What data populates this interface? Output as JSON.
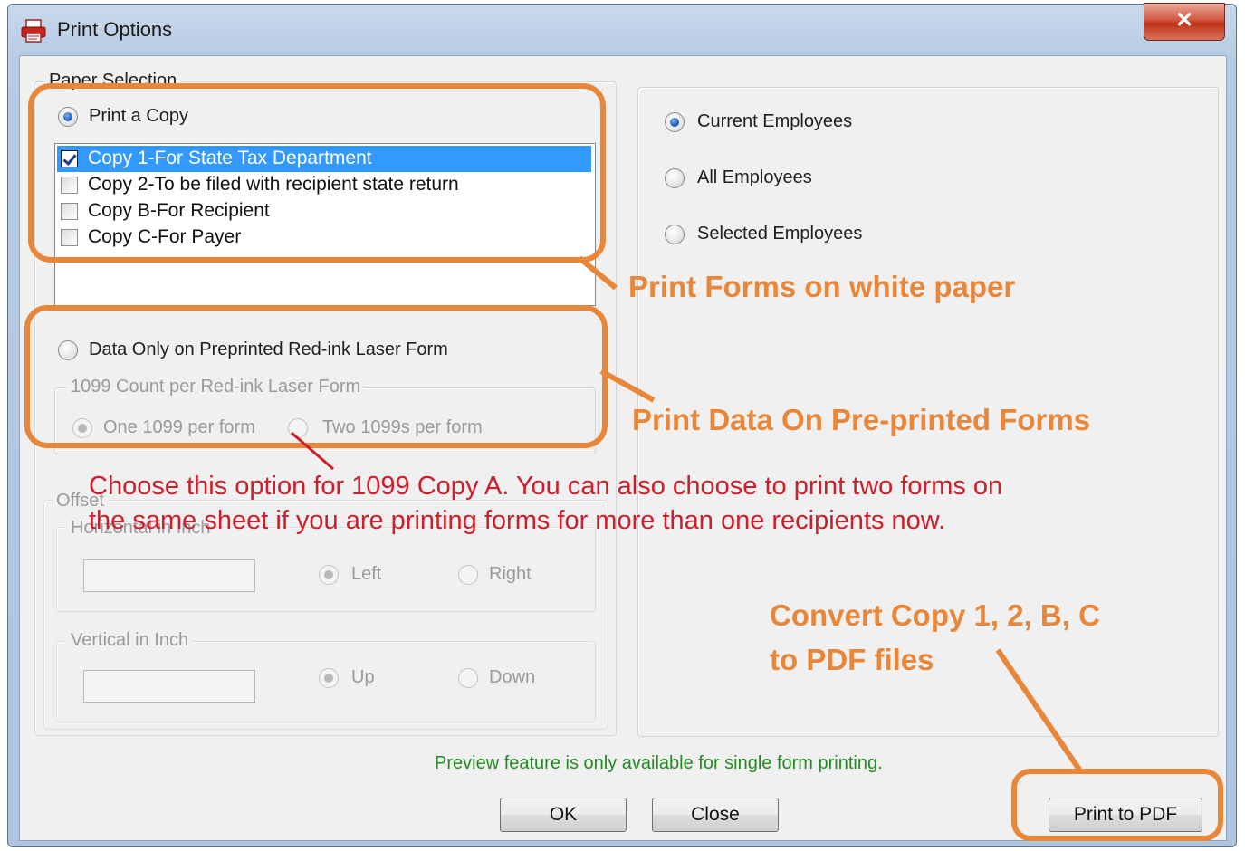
{
  "window": {
    "title": "Print Options",
    "close_symbol": "✕"
  },
  "paper_selection": {
    "label": "Paper Selection",
    "print_copy_label": "Print a Copy",
    "print_copy_selected": true,
    "copies": [
      {
        "label": "Copy 1-For State Tax Department",
        "checked": true,
        "selected": true
      },
      {
        "label": "Copy 2-To be filed with recipient state return",
        "checked": false,
        "selected": false
      },
      {
        "label": "Copy B-For Recipient",
        "checked": false,
        "selected": false
      },
      {
        "label": "Copy C-For Payer",
        "checked": false,
        "selected": false
      }
    ],
    "data_only_label": "Data Only on Preprinted Red-ink Laser Form",
    "data_only_selected": false,
    "count_group_label": "1099 Count per Red-ink Laser Form",
    "one_per_form_label": "One 1099 per form",
    "two_per_form_label": "Two 1099s per form"
  },
  "offset": {
    "label": "Offset",
    "horizontal_label": "Horizontal in Inch",
    "left_label": "Left",
    "right_label": "Right",
    "vertical_label": "Vertical in Inch",
    "up_label": "Up",
    "down_label": "Down"
  },
  "employees": {
    "current_label": "Current Employees",
    "all_label": "All Employees",
    "selected_label": "Selected Employees"
  },
  "footer": {
    "preview_note": "Preview feature is only available for single form printing.",
    "ok_label": "OK",
    "close_label": "Close",
    "print_pdf_label": "Print to PDF"
  },
  "annotations": {
    "white_paper": "Print Forms on white paper",
    "preprinted": "Print Data On Pre-printed Forms",
    "copy_a_line1": "Choose this option for 1099 Copy A. You can also choose to print two forms on",
    "copy_a_line2": "the same sheet if you are printing forms for more than one recipients now.",
    "pdf_line1": "Convert Copy 1, 2, B, C",
    "pdf_line2": "to PDF files"
  },
  "colors": {
    "annotation_orange": "#e8863a",
    "annotation_red": "#cc1f2b",
    "selection_blue": "#3399ff",
    "note_green": "#228b22"
  },
  "icons": {
    "app": "printer-icon",
    "close": "close-icon"
  }
}
